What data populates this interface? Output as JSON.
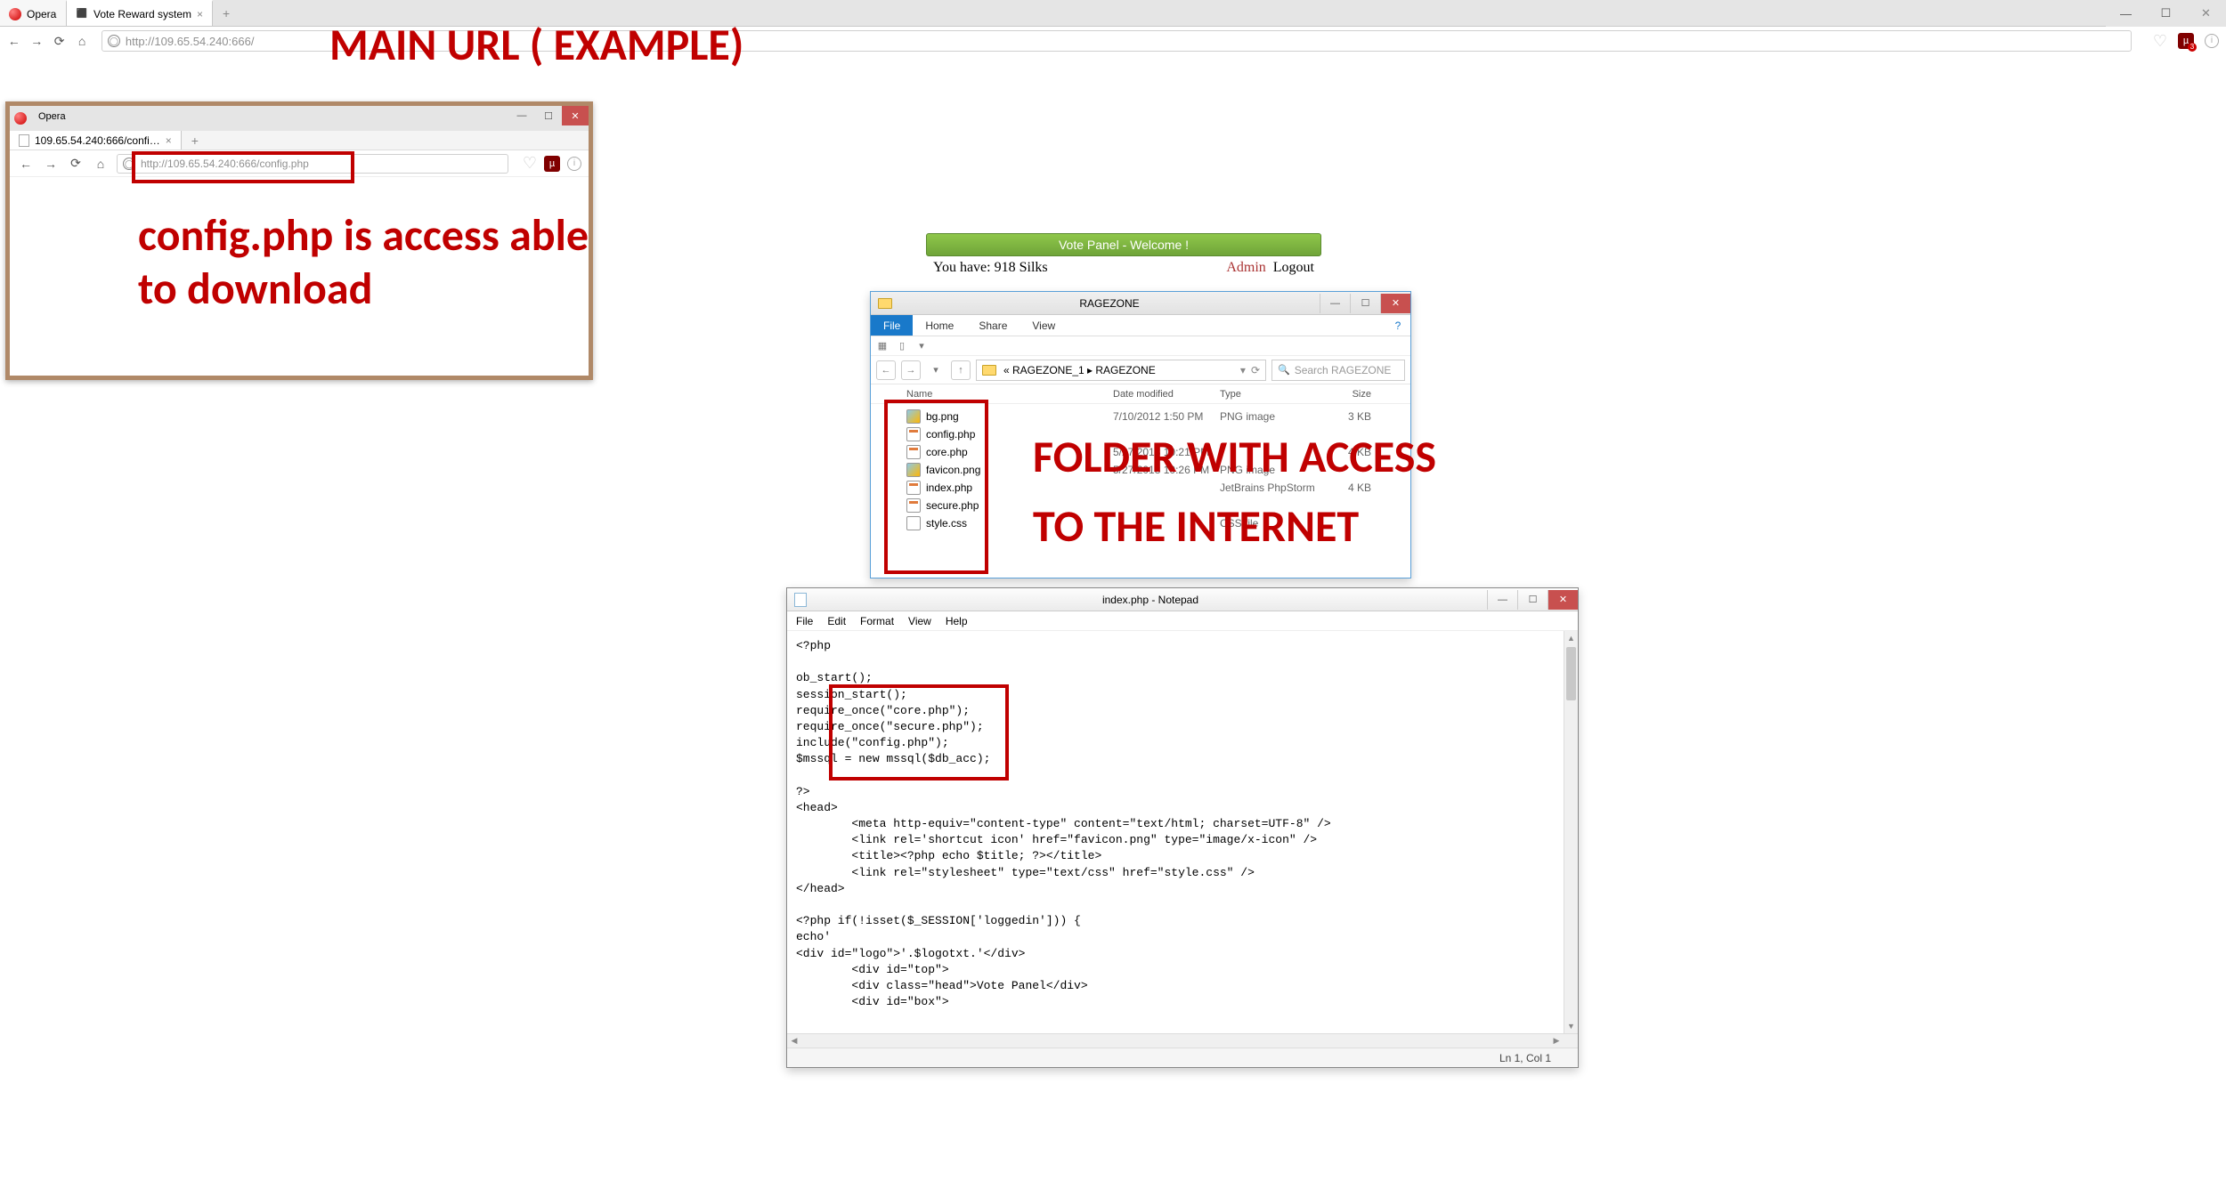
{
  "main": {
    "tab_opera": "Opera",
    "tab_active": "Vote Reward system",
    "url": "http://109.65.54.240:666/",
    "ublock_badge": "3"
  },
  "annotations": {
    "main_url": "MAIN URL ( EXAMPLE)",
    "config_line1": "config.php is access able",
    "config_line2": "to download",
    "folder_line1": "FOLDER WITH ACCESS",
    "folder_line2": "TO THE INTERNET"
  },
  "small_browser": {
    "tab_opera": "Opera",
    "tab_label": "109.65.54.240:666/confi…",
    "url": "http://109.65.54.240:666/config.php"
  },
  "vote": {
    "header": "Vote Panel - Welcome !",
    "silks_text": "You have: 918 Silks",
    "admin": "Admin",
    "logout": "Logout"
  },
  "explorer": {
    "title": "RAGEZONE",
    "ribbon": {
      "file": "File",
      "home": "Home",
      "share": "Share",
      "view": "View"
    },
    "path_prefix": "« RAGEZONE_1 ▸ RAGEZONE",
    "search_placeholder": "Search RAGEZONE",
    "cols": {
      "name": "Name",
      "date": "Date modified",
      "type": "Type",
      "size": "Size"
    },
    "files": [
      {
        "name": "bg.png",
        "date": "7/10/2012 1:50 PM",
        "type": "PNG image",
        "size": "3 KB"
      },
      {
        "name": "config.php",
        "date": "",
        "type": "",
        "size": ""
      },
      {
        "name": "core.php",
        "date": "5/27/2013 10:21 PM",
        "type": "",
        "size": "4 KB"
      },
      {
        "name": "favicon.png",
        "date": "5/27/2013 10:26 PM",
        "type": "PNG image",
        "size": ""
      },
      {
        "name": "index.php",
        "date": "",
        "type": "JetBrains PhpStorm",
        "size": "4 KB"
      },
      {
        "name": "secure.php",
        "date": "",
        "type": "",
        "size": ""
      },
      {
        "name": "style.css",
        "date": "",
        "type": "CSS file",
        "size": ""
      }
    ]
  },
  "notepad": {
    "title": "index.php - Notepad",
    "menu": {
      "file": "File",
      "edit": "Edit",
      "format": "Format",
      "view": "View",
      "help": "Help"
    },
    "status": "Ln 1, Col 1",
    "code": "<?php\n\nob_start();\nsession_start();\nrequire_once(\"core.php\");\nrequire_once(\"secure.php\");\ninclude(\"config.php\");\n$mssql = new mssql($db_acc);\n\n?>\n<head>\n        <meta http-equiv=\"content-type\" content=\"text/html; charset=UTF-8\" />\n        <link rel='shortcut icon' href=\"favicon.png\" type=\"image/x-icon\" />\n        <title><?php echo $title; ?></title>\n        <link rel=\"stylesheet\" type=\"text/css\" href=\"style.css\" />\n</head>\n\n<?php if(!isset($_SESSION['loggedin'])) {\necho'\n<div id=\"logo\">'.$logotxt.'</div>\n        <div id=\"top\">\n        <div class=\"head\">Vote Panel</div>\n        <div id=\"box\">"
  }
}
